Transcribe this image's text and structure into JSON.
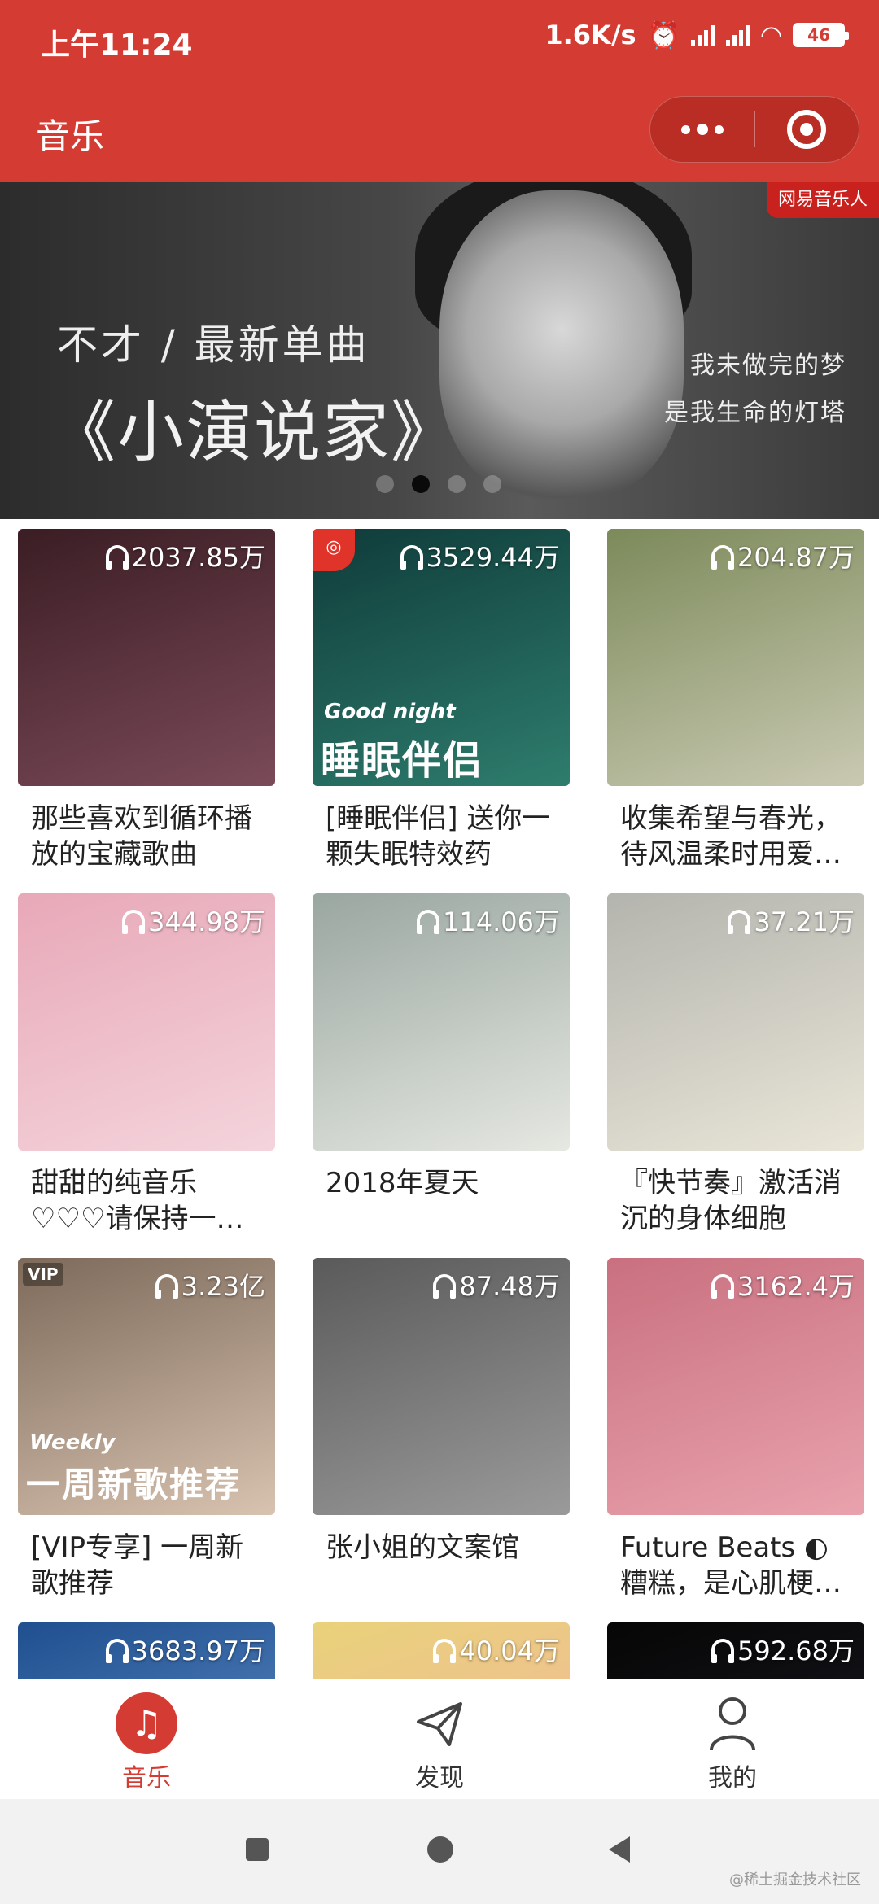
{
  "status_bar": {
    "time": "上午11:24",
    "net_speed": "1.6K/s",
    "battery": "46"
  },
  "header": {
    "title": "音乐"
  },
  "banner": {
    "badge": "网易音乐人",
    "subtitle": "不才 / 最新单曲",
    "title": "《小演说家》",
    "lyric_line1": "我未做完的梦",
    "lyric_line2": "是我生命的灯塔"
  },
  "playlists": [
    {
      "title": "那些喜欢到循环播放的宝藏歌曲",
      "plays": "2037.85万",
      "art": "anime-girl",
      "colors": [
        "#3b1d24",
        "#7a4a58"
      ]
    },
    {
      "title": "[睡眠伴侣] 送你一颗失眠特效药",
      "plays": "3529.44万",
      "art": "good-night",
      "colors": [
        "#0f3b3a",
        "#2e7d6d"
      ],
      "overlay_en": "Good night",
      "overlay_zh": "睡眠伴侣"
    },
    {
      "title": "收集希望与春光，待风温柔时用爱…",
      "plays": "204.87万",
      "art": "girls-on-grass",
      "colors": [
        "#7c8a5a",
        "#c9c9b2"
      ]
    },
    {
      "title": "甜甜的纯音乐♡♡♡请保持一…",
      "plays": "344.98万",
      "art": "pink-collage",
      "colors": [
        "#e8a8b8",
        "#f4d4dc"
      ]
    },
    {
      "title": "2018年夏天",
      "plays": "114.06万",
      "art": "anime-boy",
      "colors": [
        "#9aa6a0",
        "#e6e8e2"
      ]
    },
    {
      "title": "『快节奏』激活消沉的身体细胞",
      "plays": "37.21万",
      "art": "parking-garage",
      "colors": [
        "#b4b4ae",
        "#e9e6d8"
      ]
    },
    {
      "title": "[VIP专享] 一周新歌推荐",
      "plays": "3.23亿",
      "art": "weekly",
      "colors": [
        "#7d6a5a",
        "#d8c2b0"
      ],
      "vip": "VIP",
      "overlay_en": "Weekly",
      "overlay_zh": "一周新歌推荐"
    },
    {
      "title": "张小姐的文案馆",
      "plays": "87.48万",
      "art": "hazy-sun",
      "colors": [
        "#5a5a5a",
        "#9a9a9a"
      ]
    },
    {
      "title": "Future Beats ◐ 糟糕，是心肌梗塞…",
      "plays": "3162.4万",
      "art": "astronaut",
      "colors": [
        "#c9707f",
        "#e9a2ad"
      ]
    },
    {
      "title": "",
      "plays": "3683.97万",
      "art": "moon-blue",
      "colors": [
        "#1f4f8f",
        "#6d9ad3"
      ]
    },
    {
      "title": "",
      "plays": "40.04万",
      "art": "yellow-anime",
      "colors": [
        "#e9d27a",
        "#f4b0a4"
      ]
    },
    {
      "title": "",
      "plays": "592.68万",
      "art": "starry-night",
      "colors": [
        "#060606",
        "#1e1e28"
      ]
    }
  ],
  "tabbar": {
    "items": [
      {
        "label": "音乐",
        "icon": "music-note-icon",
        "active": true
      },
      {
        "label": "发现",
        "icon": "paper-plane-icon",
        "active": false
      },
      {
        "label": "我的",
        "icon": "user-icon",
        "active": false
      }
    ]
  },
  "watermark": "@稀土掘金技术社区",
  "colors": {
    "brand_red": "#d43c33"
  }
}
